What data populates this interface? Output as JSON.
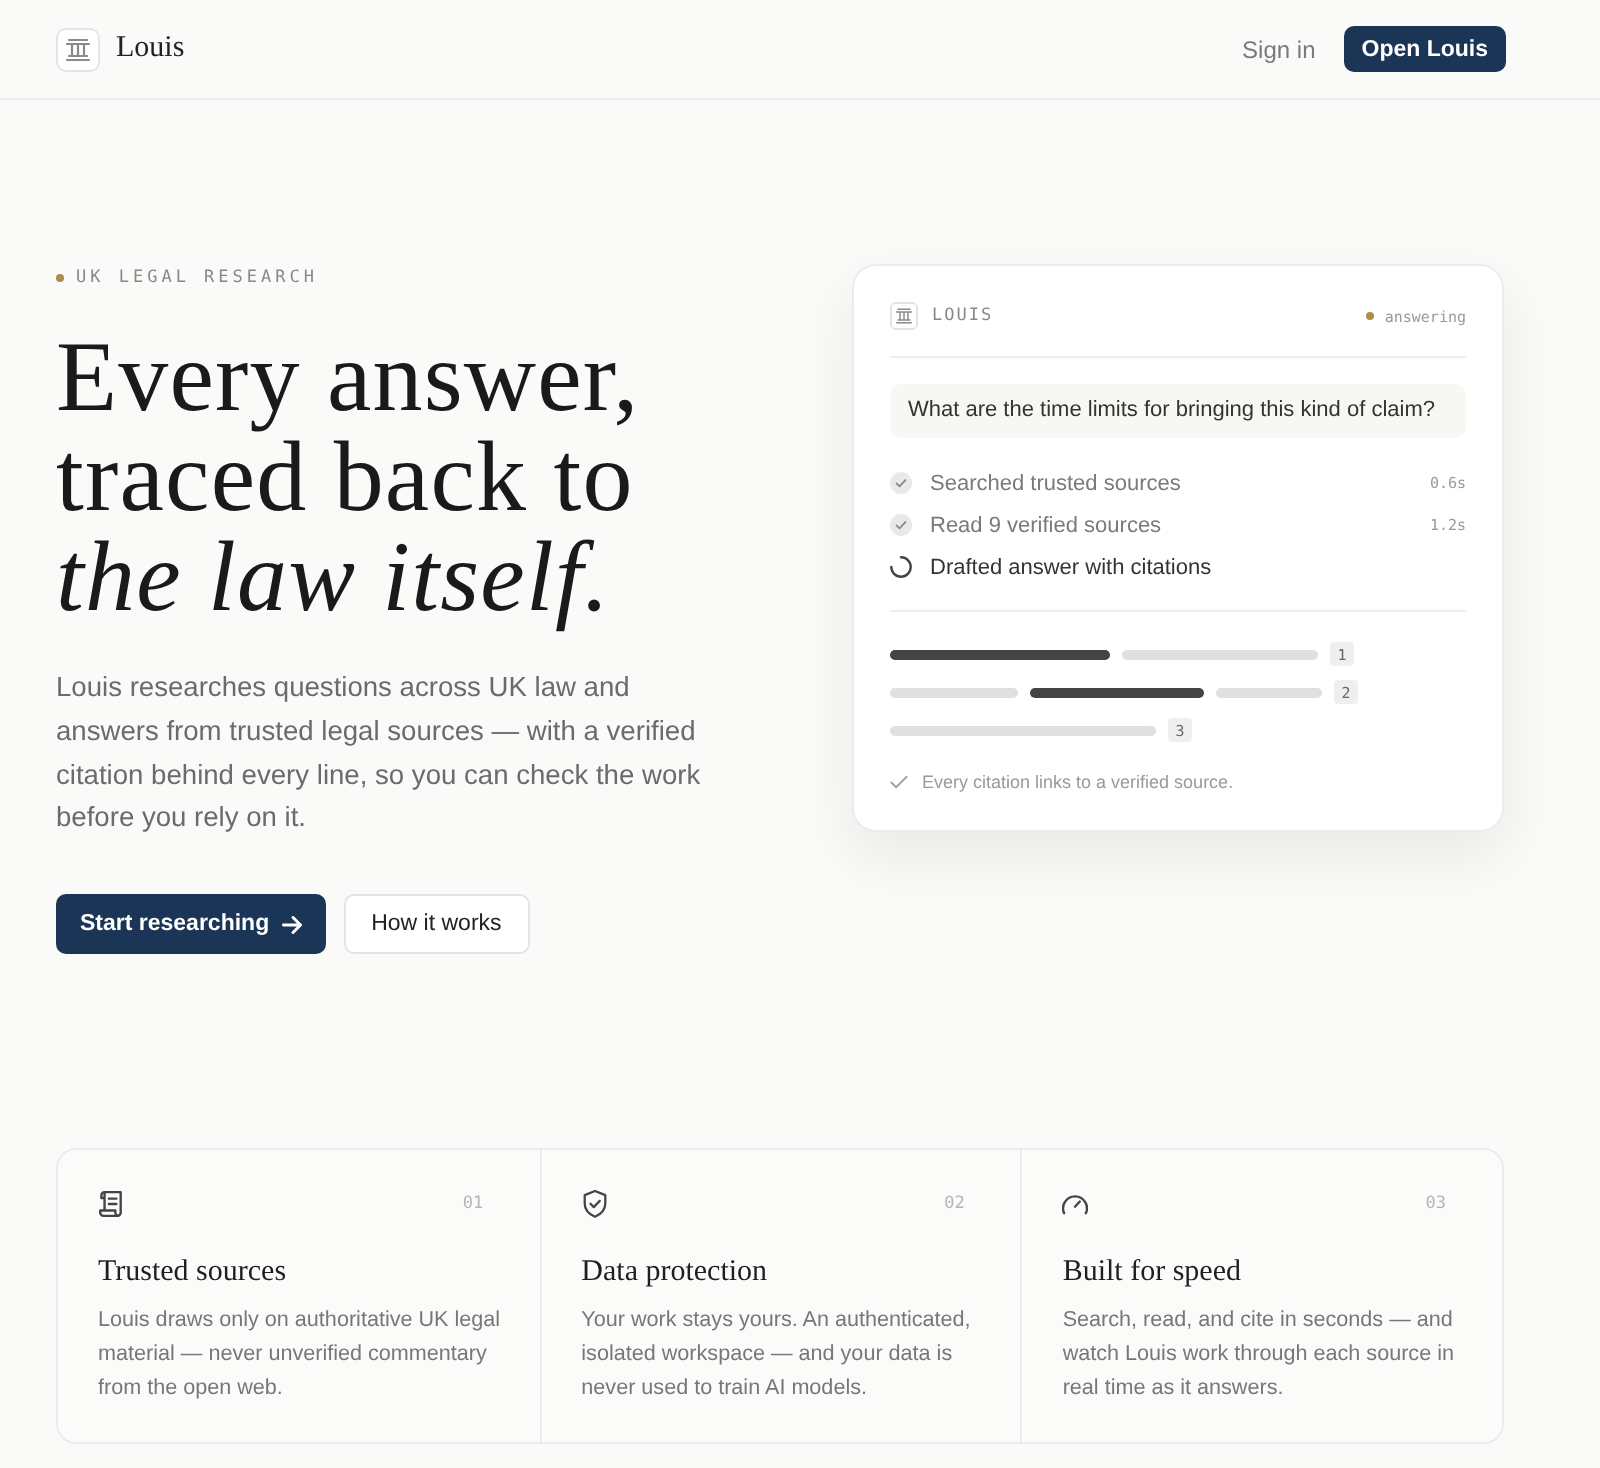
{
  "header": {
    "brand": "Louis",
    "links": [
      {
        "label": "Sign in",
        "kind": "link"
      },
      {
        "label": "Open Louis",
        "kind": "button"
      }
    ]
  },
  "hero": {
    "eyebrow": "UK LEGAL RESEARCH",
    "heading": "Every answer, traced back to *the law itself.*",
    "description": "Louis researches questions across UK law and answers from trusted legal sources — with a verified citation behind every line, so you can check the work before you rely on it.",
    "buttons": [
      {
        "label": "Start researching",
        "kind": "primary"
      },
      {
        "label": "How it works",
        "kind": "secondary"
      }
    ]
  },
  "card": {
    "title": "LOUIS",
    "status": "answering",
    "question": "What are the time limits for bringing this kind of claim?",
    "steps": [
      {
        "label": "Searched trusted sources",
        "time": "0.6s",
        "done": true
      },
      {
        "label": "Read 9 verified sources",
        "time": "1.2s",
        "done": true
      },
      {
        "label": "Drafted answer with citations",
        "done": false
      }
    ],
    "citations": [
      {
        "number": "1",
        "segments": [
          {
            "highlighted": true
          },
          {
            "highlighted": false
          }
        ]
      },
      {
        "number": "2",
        "segments": [
          {
            "highlighted": false
          },
          {
            "highlighted": true
          },
          {
            "highlighted": false
          }
        ]
      },
      {
        "number": "3",
        "segments": [
          {
            "highlighted": false
          }
        ]
      }
    ],
    "footer": "Every citation links to a verified source."
  },
  "features": [
    {
      "number": "01",
      "title": "Trusted sources",
      "description": "Louis draws only on authoritative UK legal material — never unverified commentary from the open web."
    },
    {
      "number": "02",
      "title": "Data protection",
      "description": "Your work stays yours. An authenticated, isolated workspace — and your data is never used to train AI models."
    },
    {
      "number": "03",
      "title": "Built for speed",
      "description": "Search, read, and cite in seconds — and watch Louis work through each source in real time as it answers."
    }
  ]
}
